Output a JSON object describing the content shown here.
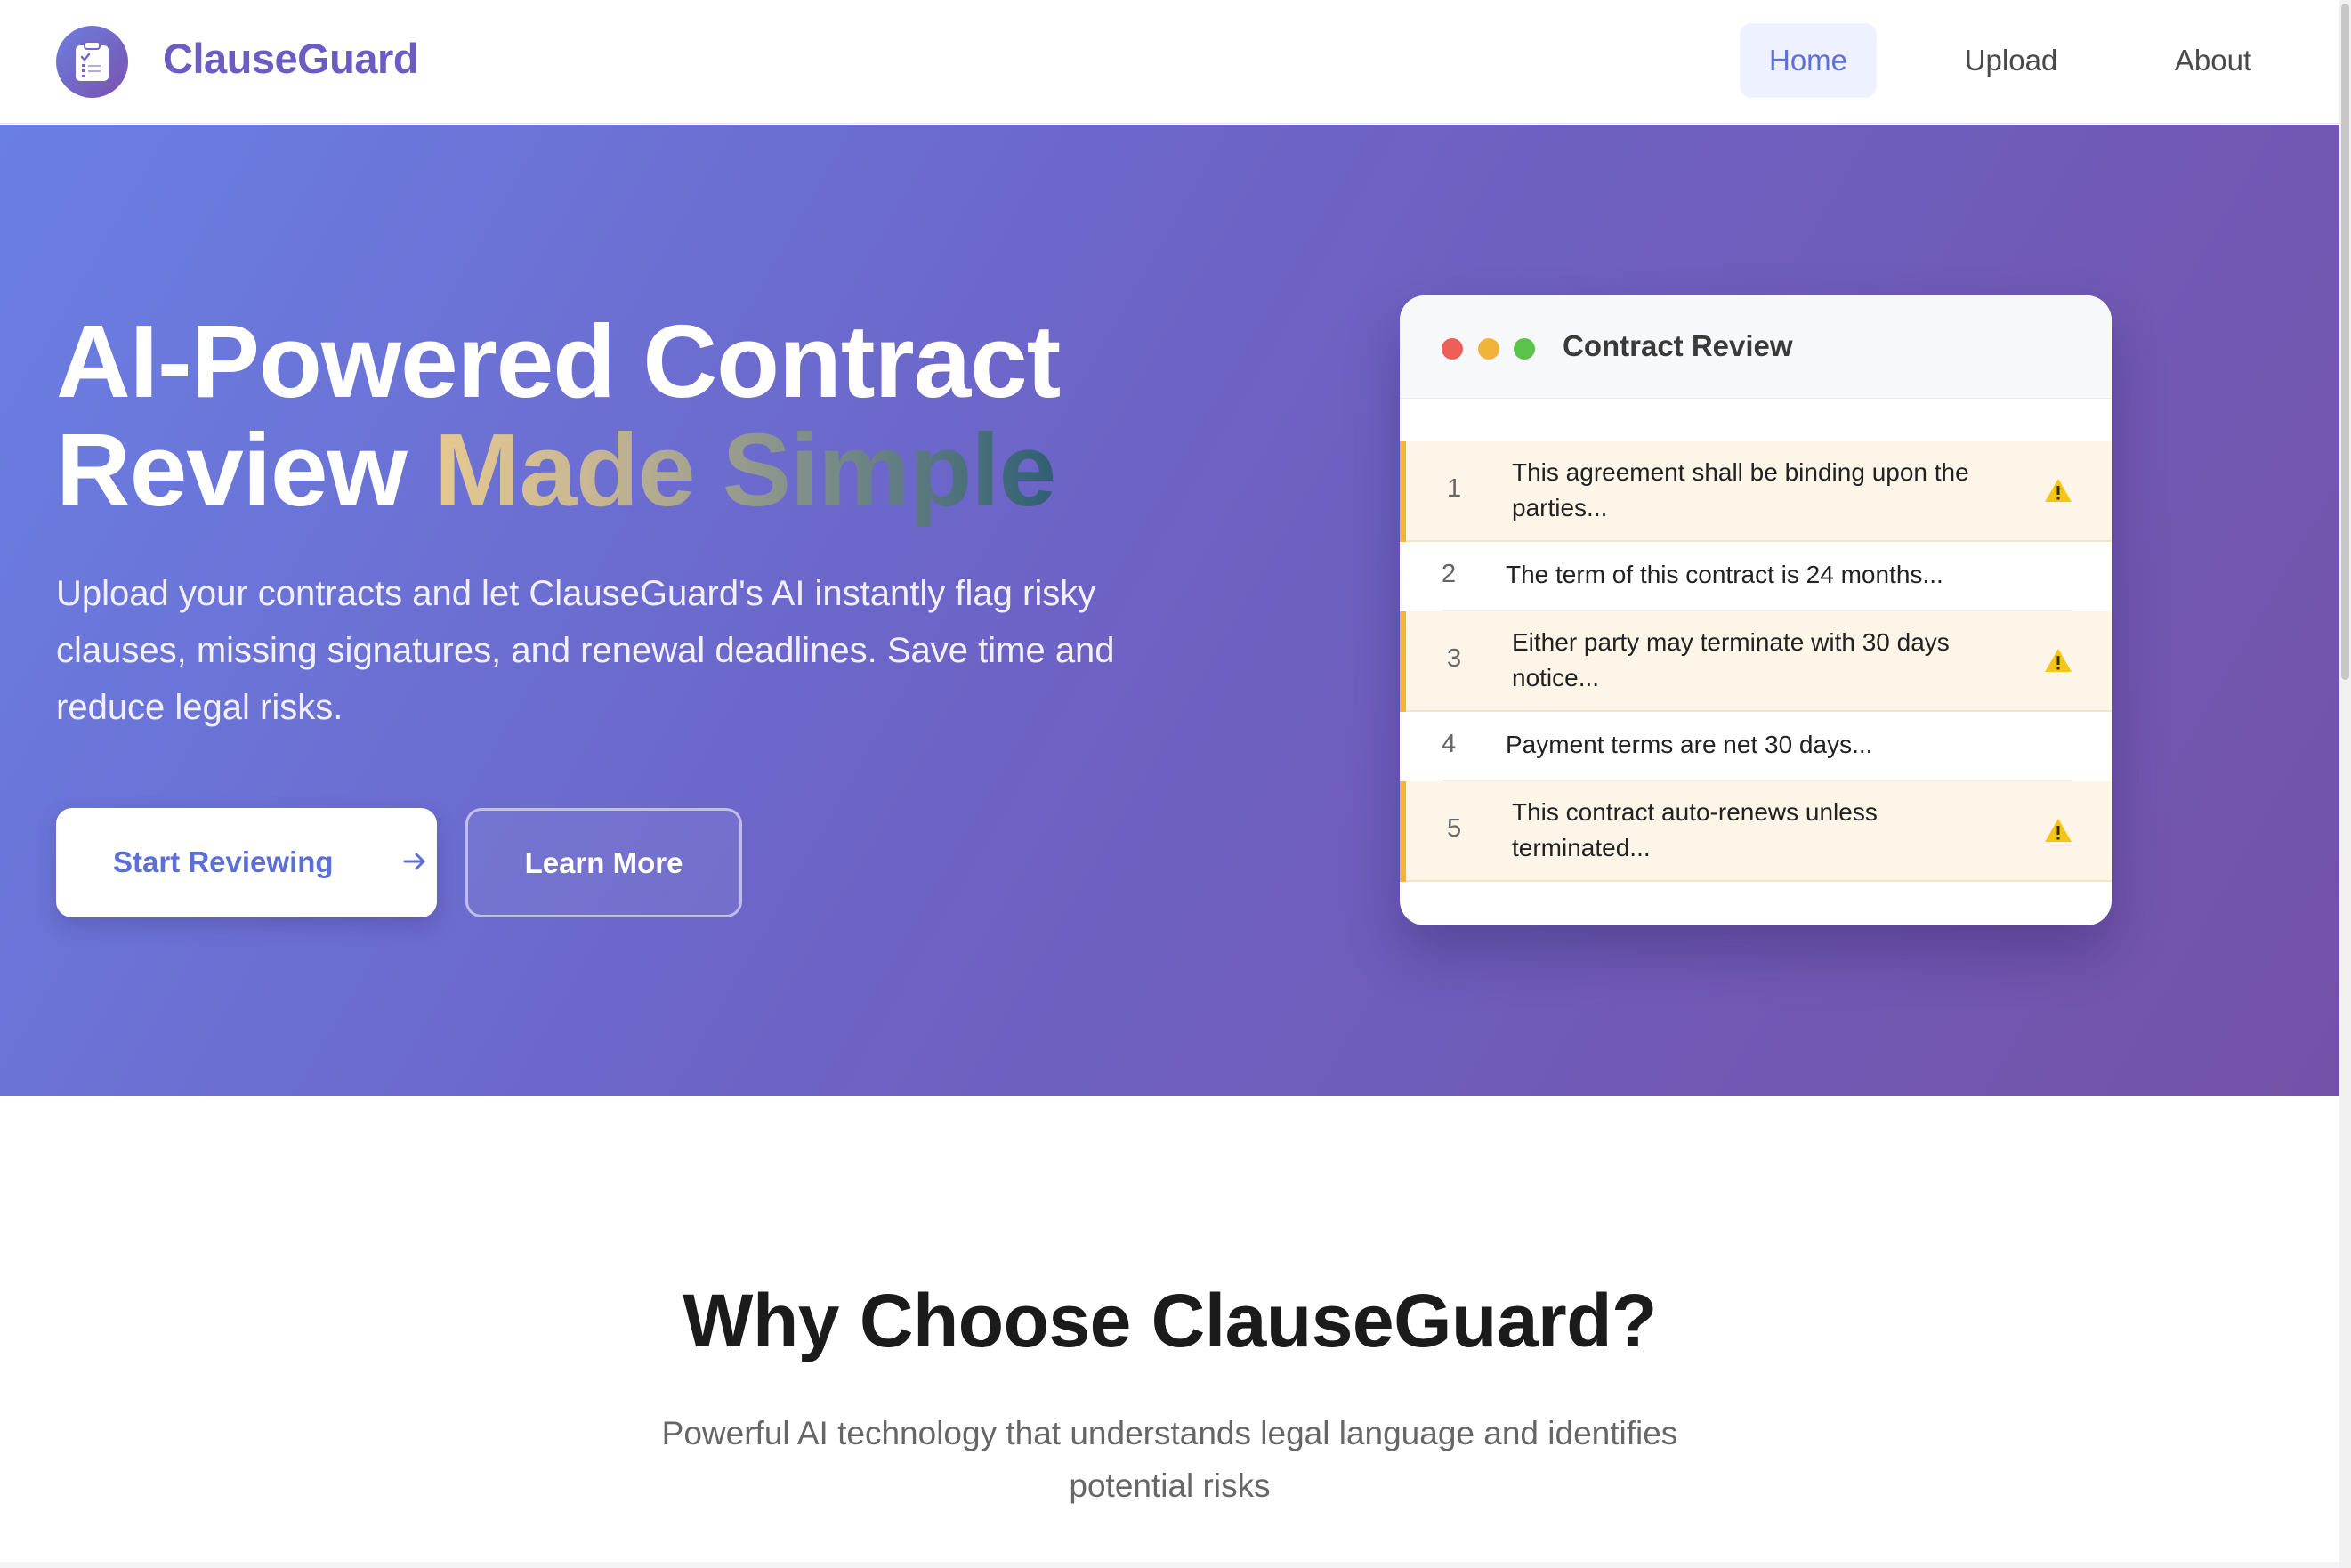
{
  "navbar": {
    "brand_name": "ClauseGuard",
    "logo_icon": "clipboard-check-icon",
    "links": [
      {
        "label": "Home",
        "active": true
      },
      {
        "label": "Upload",
        "active": false
      },
      {
        "label": "About",
        "active": false
      }
    ]
  },
  "hero": {
    "title_line1": "AI-Powered Contract",
    "title_line2_plain": "Review",
    "title_line2_accent": "Made Simple",
    "subtitle": "Upload your contracts and let ClauseGuard's AI instantly flag risky clauses, missing signatures, and renewal deadlines. Save time and reduce legal risks.",
    "primary_button": {
      "label": "Start Reviewing",
      "icon": "arrow-right-icon"
    },
    "secondary_button": {
      "label": "Learn More"
    }
  },
  "review_card": {
    "title": "Contract Review",
    "window_controls": [
      "close-dot",
      "minimize-dot",
      "maximize-dot"
    ],
    "clauses": [
      {
        "number": "1",
        "text": "This agreement shall be binding upon the parties...",
        "flagged": true
      },
      {
        "number": "2",
        "text": "The term of this contract is 24 months...",
        "flagged": false
      },
      {
        "number": "3",
        "text": "Either party may terminate with 30 days notice...",
        "flagged": true
      },
      {
        "number": "4",
        "text": "Payment terms are net 30 days...",
        "flagged": false
      },
      {
        "number": "5",
        "text": "This contract auto-renews unless terminated...",
        "flagged": true
      }
    ]
  },
  "why_section": {
    "title": "Why Choose ClauseGuard?",
    "subtitle": "Powerful AI technology that understands legal language and identifies potential risks"
  },
  "colors": {
    "brand": "#6b5bc2",
    "hero_gradient_start": "#6a7fe3",
    "hero_gradient_end": "#7452a8",
    "warning": "#f3b33d",
    "nav_active_bg": "#eef1ff",
    "nav_active_text": "#5c70d8"
  }
}
